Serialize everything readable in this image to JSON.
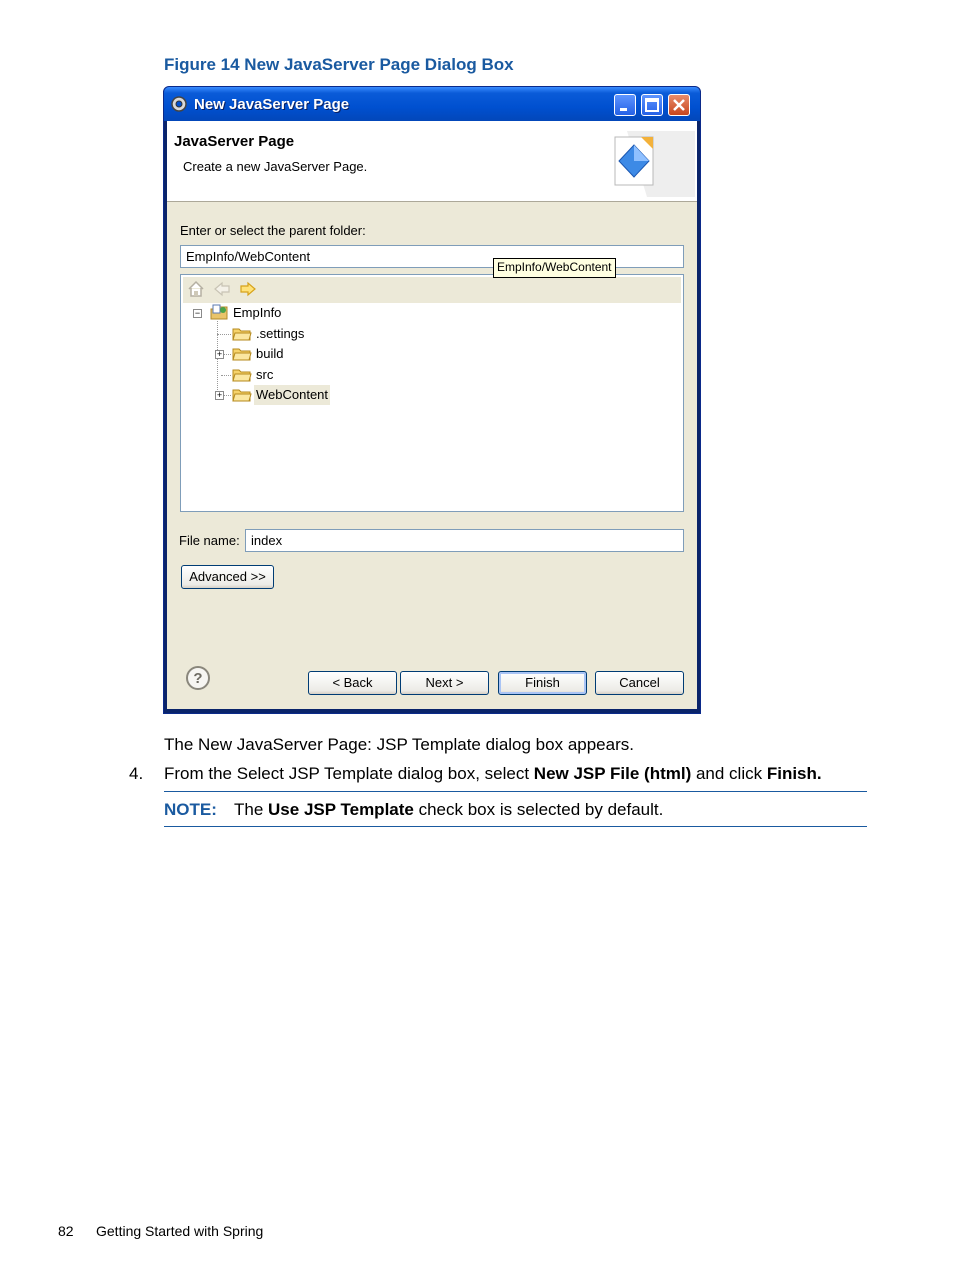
{
  "figure_caption": "Figure 14 New JavaServer Page Dialog Box",
  "dialog": {
    "title": "New JavaServer Page",
    "page_title": "JavaServer Page",
    "page_description": "Create a new JavaServer Page.",
    "parent_folder_label": "Enter or select the parent folder:",
    "parent_folder_value": "EmpInfo/WebContent",
    "tooltip": "EmpInfo/WebContent",
    "tree": {
      "root": "EmpInfo",
      "children": [
        ".settings",
        "build",
        "src",
        "WebContent"
      ]
    },
    "file_name_label": "File name:",
    "file_name_value": "index",
    "advanced_button": "Advanced >>",
    "buttons": {
      "back": "< Back",
      "next": "Next >",
      "finish": "Finish",
      "cancel": "Cancel"
    }
  },
  "body": {
    "para1": "The New JavaServer Page: JSP Template dialog box appears.",
    "step4": {
      "number": "4.",
      "prefix": "From the Select JSP Template dialog box, select ",
      "bold1": "New JSP File (html)",
      "middle": " and click ",
      "bold2": "Finish."
    },
    "note": {
      "label": "NOTE:",
      "prefix": "The ",
      "bold": "Use JSP Template",
      "suffix": " check box is selected by default."
    }
  },
  "footer": {
    "page_number": "82",
    "title": "Getting Started with Spring"
  },
  "colors": {
    "accent": "#1a5aa0",
    "titlebar": "#0050d0"
  }
}
